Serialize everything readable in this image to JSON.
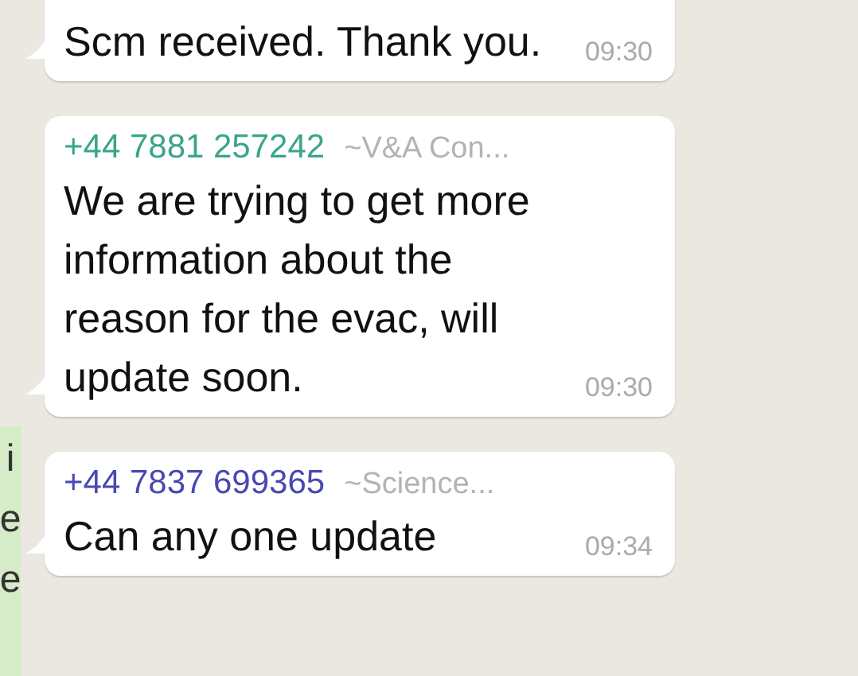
{
  "side_fragment": {
    "letters": [
      "i",
      "e",
      "e"
    ]
  },
  "messages": [
    {
      "text": "Scm received. Thank you.",
      "time": "09:30"
    },
    {
      "sender": {
        "phone": "+44 7881 257242",
        "name": "~V&A Con...",
        "color": "#3aa58a"
      },
      "text": "We are trying to get more information about the reason for the evac, will update soon.",
      "time": "09:30"
    },
    {
      "sender": {
        "phone": "+44 7837 699365",
        "name": "~Science...",
        "color": "#4848b4"
      },
      "text": "Can any one update",
      "time": "09:34"
    }
  ]
}
